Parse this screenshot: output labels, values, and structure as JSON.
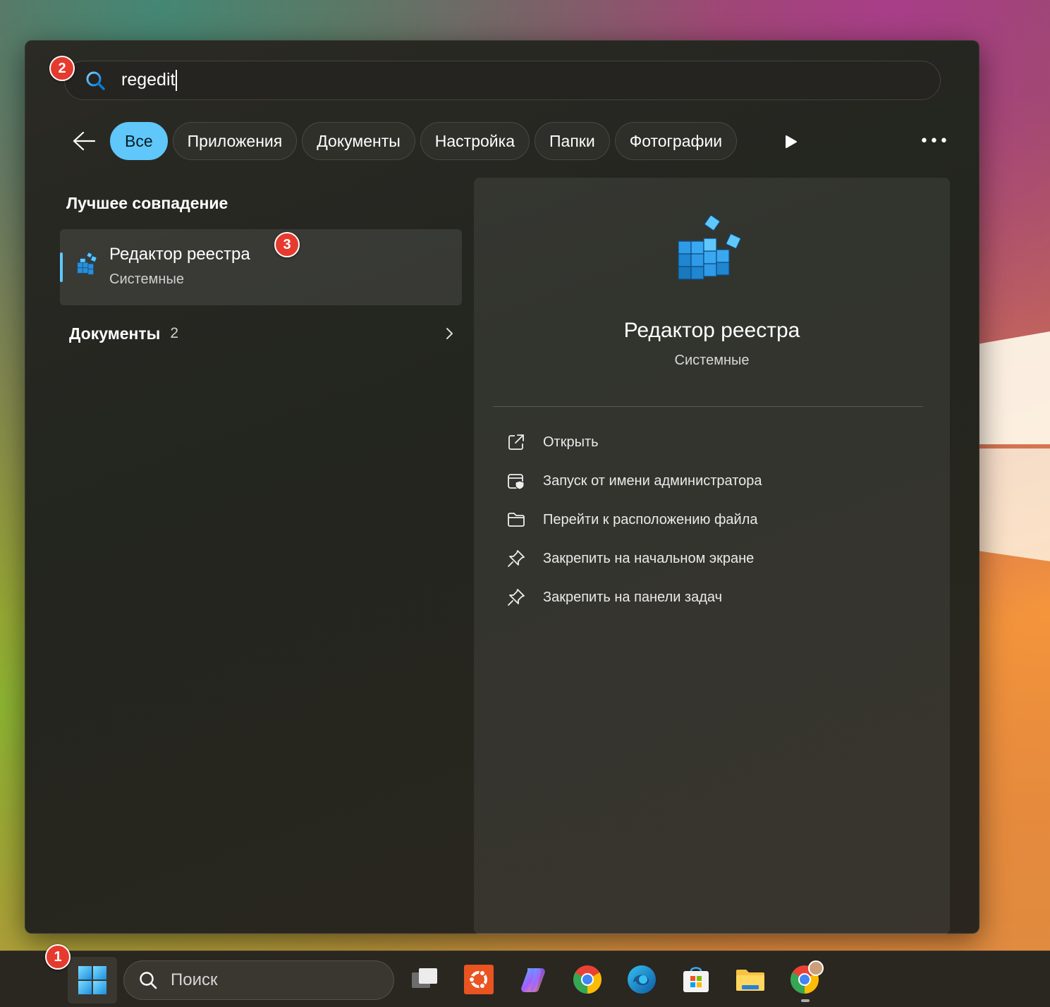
{
  "search": {
    "query": "regedit"
  },
  "filters": {
    "back_icon": "arrow-left-icon",
    "chips": [
      {
        "label": "Все",
        "active": true
      },
      {
        "label": "Приложения",
        "active": false
      },
      {
        "label": "Документы",
        "active": false
      },
      {
        "label": "Настройка",
        "active": false
      },
      {
        "label": "Папки",
        "active": false
      },
      {
        "label": "Фотографии",
        "active": false
      }
    ],
    "more_label": "•••"
  },
  "results": {
    "best_match_title": "Лучшее совпадение",
    "best_match": {
      "name": "Редактор реестра",
      "category": "Системные",
      "icon": "registry-editor-icon"
    },
    "documents": {
      "label": "Документы",
      "count": "2"
    }
  },
  "detail": {
    "title": "Редактор реестра",
    "subtitle": "Системные",
    "actions": [
      {
        "label": "Открыть",
        "icon": "open-external-icon"
      },
      {
        "label": "Запуск от имени администратора",
        "icon": "admin-shield-icon"
      },
      {
        "label": "Перейти к расположению файла",
        "icon": "folder-icon"
      },
      {
        "label": "Закрепить на начальном экране",
        "icon": "pin-icon"
      },
      {
        "label": "Закрепить на панели задач",
        "icon": "pin-icon"
      }
    ]
  },
  "annotations": {
    "badge1": "1",
    "badge2": "2",
    "badge3": "3"
  },
  "taskbar": {
    "search_placeholder": "Поиск",
    "apps": [
      "task-view-icon",
      "ubuntu-icon",
      "copilot-icon",
      "chrome-icon",
      "edge-icon",
      "store-icon",
      "file-explorer-icon",
      "chrome-profile-icon"
    ]
  },
  "colors": {
    "accent": "#5fc7fa",
    "badge": "#e63a2e"
  }
}
